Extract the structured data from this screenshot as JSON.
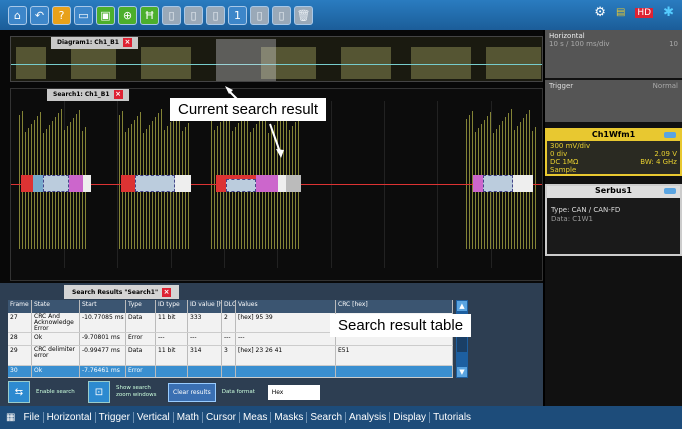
{
  "toolbar": {
    "icons": [
      "home-icon",
      "undo-icon",
      "help-icon",
      "folder-icon",
      "save-icon",
      "zoom-icon",
      "run-icon",
      "blank-icon",
      "blank-icon",
      "blank-icon",
      "info-icon",
      "blank-icon",
      "blank-icon",
      "delete-icon"
    ],
    "right_icons": [
      "settings-icon",
      "config-icon",
      "hd-icon",
      "bluetooth-icon"
    ]
  },
  "overview": {
    "tab_label": "Diagram1: Ch1_B1"
  },
  "search_pane": {
    "tab_label": "Search1: Ch1_B1"
  },
  "callouts": {
    "current_result": "Current search result",
    "result_table": "Search result table"
  },
  "results": {
    "tab_label": "Search Results \"Search1\"",
    "headers": [
      "Frame",
      "State",
      "Start",
      "Type",
      "ID type",
      "ID value [hex]",
      "DLC",
      "Values",
      "CRC [hex]"
    ],
    "rows": [
      {
        "frame": "27",
        "state": "CRC And Acknowledge Error",
        "start": "-10.77085 ms",
        "type": "Data",
        "id_type": "11 bit",
        "id_value": "333",
        "dlc": "2",
        "values": "[hex] 95 39",
        "crc": ""
      },
      {
        "frame": "28",
        "state": "Ok",
        "start": "-9.70801 ms",
        "type": "Error",
        "id_type": "---",
        "id_value": "---",
        "dlc": "---",
        "values": "---",
        "crc": ""
      },
      {
        "frame": "29",
        "state": "CRC delimiter error",
        "start": "-0.99477 ms",
        "type": "Data",
        "id_type": "11 bit",
        "id_value": "314",
        "dlc": "3",
        "values": "[hex] 23 26 41",
        "crc": "E51"
      },
      {
        "frame": "30",
        "state": "Ok",
        "start": "-7.76461 ms",
        "type": "Error",
        "id_type": "",
        "id_value": "",
        "dlc": "",
        "values": "",
        "crc": ""
      }
    ],
    "enable_label": "Enable search",
    "show_label": "Show search zoom windows",
    "clear_label": "Clear results",
    "format_label": "Data format",
    "format_value": "Hex"
  },
  "right_panel": {
    "horizontal_title": "Horizontal",
    "horizontal_line1": "10 s / 100 ms/div",
    "horizontal_value": "10",
    "trigger_title": "Trigger",
    "trigger_mode": "Normal",
    "ch_title": "Ch1Wfm1",
    "ch_line1": "300 mV/div",
    "ch_line2a": "0 div",
    "ch_line2b": "2.09 V",
    "ch_line3a": "DC 1MΩ",
    "ch_line3b": "BW: 4 GHz",
    "ch_line4": "Sample",
    "serial_title": "Serbus1",
    "serial_type": "Type: CAN / CAN-FD",
    "serial_data": "Data: C1W1"
  },
  "menubar": {
    "items": [
      "File",
      "Horizontal",
      "Trigger",
      "Vertical",
      "Math",
      "Cursor",
      "Meas",
      "Masks",
      "Search",
      "Analysis",
      "Display",
      "Tutorials"
    ]
  }
}
